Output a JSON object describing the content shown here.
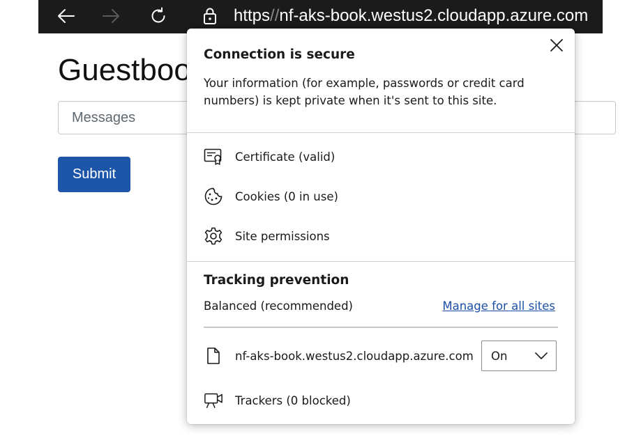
{
  "browser": {
    "url_scheme": "https",
    "url_sep": "//",
    "url_host": "nf-aks-book.westus2.cloudapp.azure.com"
  },
  "page": {
    "title": "Guestbook",
    "input_placeholder": "Messages",
    "submit_label": "Submit"
  },
  "popup": {
    "title": "Connection is secure",
    "description": "Your information (for example, passwords or credit card numbers) is kept private when it's sent to this site.",
    "items": [
      {
        "label": "Certificate (valid)",
        "icon": "certificate-icon"
      },
      {
        "label": "Cookies (0 in use)",
        "icon": "cookie-icon"
      },
      {
        "label": "Site permissions",
        "icon": "gear-icon"
      }
    ],
    "tracking": {
      "title": "Tracking prevention",
      "mode": "Balanced (recommended)",
      "manage_link": "Manage for all sites",
      "site": "nf-aks-book.westus2.cloudapp.azure.com",
      "site_setting": "On",
      "trackers": "Trackers (0 blocked)"
    }
  },
  "colors": {
    "toolbar_bg": "#1b1b1b",
    "submit_bg": "#1d55a8",
    "link": "#1d4fa5"
  }
}
